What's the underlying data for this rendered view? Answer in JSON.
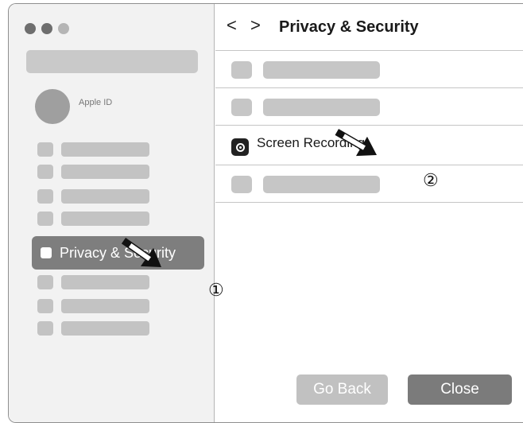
{
  "sidebar": {
    "apple_id_label": "Apple ID",
    "active_item_label": "Privacy & Security"
  },
  "header": {
    "back_glyph": "<",
    "forward_glyph": ">",
    "title": "Privacy & Security"
  },
  "main": {
    "screen_recording_label": "Screen Recording"
  },
  "footer": {
    "go_back_label": "Go Back",
    "close_label": "Close"
  },
  "annotations": {
    "step_1": "①",
    "step_2": "②"
  },
  "icons": [
    "screen-recording-icon",
    "arrow-pointer-icon",
    "checkbox-icon"
  ],
  "colors": {
    "sidebar_active": "#7e7e7e",
    "placeholder": "#c3c3c3",
    "close_button": "#7b7b7b",
    "go_back_button": "#c1c1c1"
  }
}
